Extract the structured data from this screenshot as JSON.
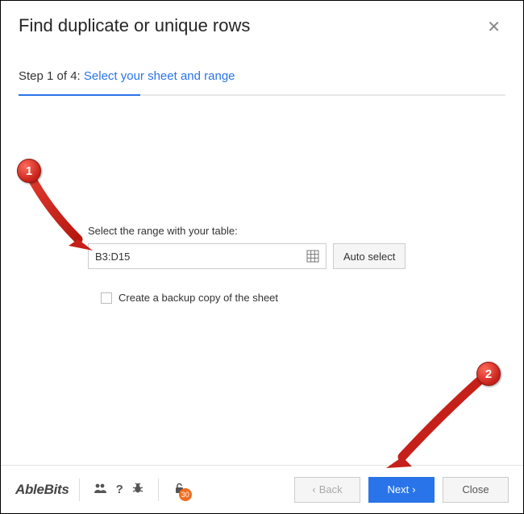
{
  "dialog": {
    "title": "Find duplicate or unique rows",
    "step_prefix": "Step 1 of 4: ",
    "step_link": "Select your sheet and range"
  },
  "form": {
    "range_label": "Select the range with your table:",
    "range_value": "B3:D15",
    "auto_select_label": "Auto select",
    "backup_label": "Create a backup copy of the sheet"
  },
  "footer": {
    "brand": "AbleBits",
    "badge_count": "30",
    "back_label": "Back",
    "next_label": "Next",
    "close_label": "Close"
  },
  "annotations": {
    "one": "1",
    "two": "2"
  }
}
